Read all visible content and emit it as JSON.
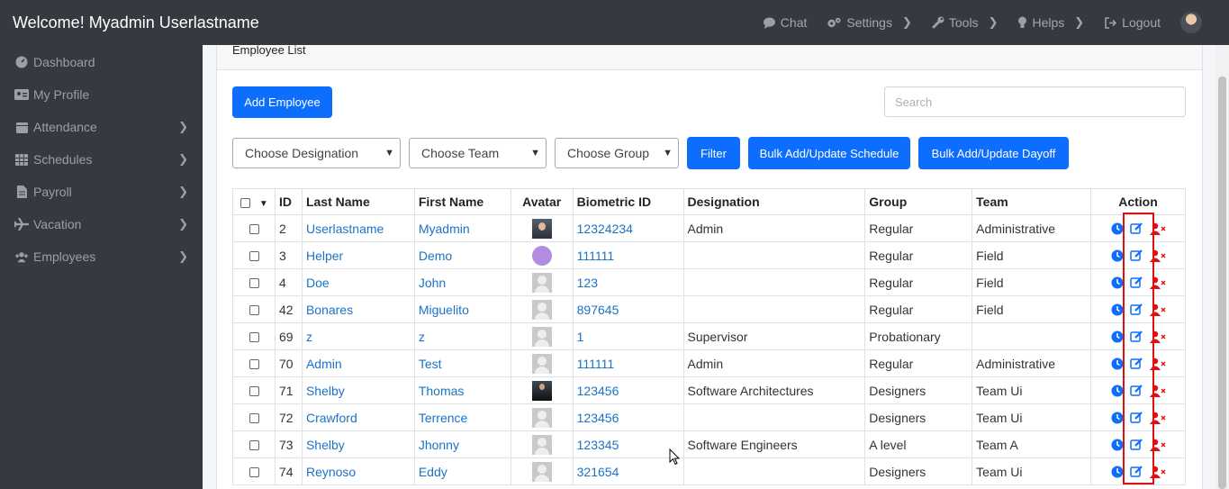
{
  "header": {
    "welcome": "Welcome! Myadmin Userlastname",
    "nav": [
      {
        "label": "Chat",
        "icon": "chat-icon",
        "chevron": false
      },
      {
        "label": "Settings",
        "icon": "gears-icon",
        "chevron": true
      },
      {
        "label": "Tools",
        "icon": "wrench-icon",
        "chevron": true
      },
      {
        "label": "Helps",
        "icon": "lightbulb-icon",
        "chevron": true
      },
      {
        "label": "Logout",
        "icon": "logout-icon",
        "chevron": false
      }
    ]
  },
  "sidebar": {
    "items": [
      {
        "label": "Dashboard",
        "icon": "dashboard-icon",
        "chevron": false
      },
      {
        "label": "My Profile",
        "icon": "id-card-icon",
        "chevron": false
      },
      {
        "label": "Attendance",
        "icon": "calendar-icon",
        "chevron": true
      },
      {
        "label": "Schedules",
        "icon": "table-icon",
        "chevron": true
      },
      {
        "label": "Payroll",
        "icon": "document-icon",
        "chevron": true
      },
      {
        "label": "Vacation",
        "icon": "plane-icon",
        "chevron": true
      },
      {
        "label": "Employees",
        "icon": "users-icon",
        "chevron": true
      }
    ]
  },
  "card": {
    "title": "Employee List",
    "add_button": "Add Employee",
    "search_placeholder": "Search"
  },
  "filters": {
    "designation": "Choose Designation",
    "team": "Choose Team",
    "group": "Choose Group",
    "filter_button": "Filter",
    "bulk_schedule": "Bulk Add/Update Schedule",
    "bulk_dayoff": "Bulk Add/Update Dayoff"
  },
  "table": {
    "columns": [
      "ID",
      "Last Name",
      "First Name",
      "Avatar",
      "Biometric ID",
      "Designation",
      "Group",
      "Team",
      "Action"
    ],
    "rows": [
      {
        "id": "2",
        "last": "Userlastname",
        "first": "Myadmin",
        "avatar": "photo1",
        "bio": "12324234",
        "designation": "Admin",
        "group": "Regular",
        "team": "Administrative"
      },
      {
        "id": "3",
        "last": "Helper",
        "first": "Demo",
        "avatar": "purple",
        "bio": "111111",
        "designation": "",
        "group": "Regular",
        "team": "Field"
      },
      {
        "id": "4",
        "last": "Doe",
        "first": "John",
        "avatar": "default",
        "bio": "123",
        "designation": "",
        "group": "Regular",
        "team": "Field"
      },
      {
        "id": "42",
        "last": "Bonares",
        "first": "Miguelito",
        "avatar": "default",
        "bio": "897645",
        "designation": "",
        "group": "Regular",
        "team": "Field"
      },
      {
        "id": "69",
        "last": "z",
        "first": "z",
        "avatar": "default",
        "bio": "1",
        "designation": "Supervisor",
        "group": "Probationary",
        "team": ""
      },
      {
        "id": "70",
        "last": "Admin",
        "first": "Test",
        "avatar": "default",
        "bio": "111111",
        "designation": "Admin",
        "group": "Regular",
        "team": "Administrative"
      },
      {
        "id": "71",
        "last": "Shelby",
        "first": "Thomas",
        "avatar": "suit",
        "bio": "123456",
        "designation": "Software Architectures",
        "group": "Designers",
        "team": "Team Ui"
      },
      {
        "id": "72",
        "last": "Crawford",
        "first": "Terrence",
        "avatar": "default",
        "bio": "123456",
        "designation": "",
        "group": "Designers",
        "team": "Team Ui"
      },
      {
        "id": "73",
        "last": "Shelby",
        "first": "Jhonny",
        "avatar": "default",
        "bio": "123345",
        "designation": "Software Engineers",
        "group": "A level",
        "team": "Team A"
      },
      {
        "id": "74",
        "last": "Reynoso",
        "first": "Eddy",
        "avatar": "default",
        "bio": "321654",
        "designation": "",
        "group": "Designers",
        "team": "Team Ui"
      }
    ]
  },
  "colors": {
    "primary": "#0d6efd",
    "link": "#1a73c8",
    "danger": "#e01010",
    "dark": "#343a40"
  }
}
